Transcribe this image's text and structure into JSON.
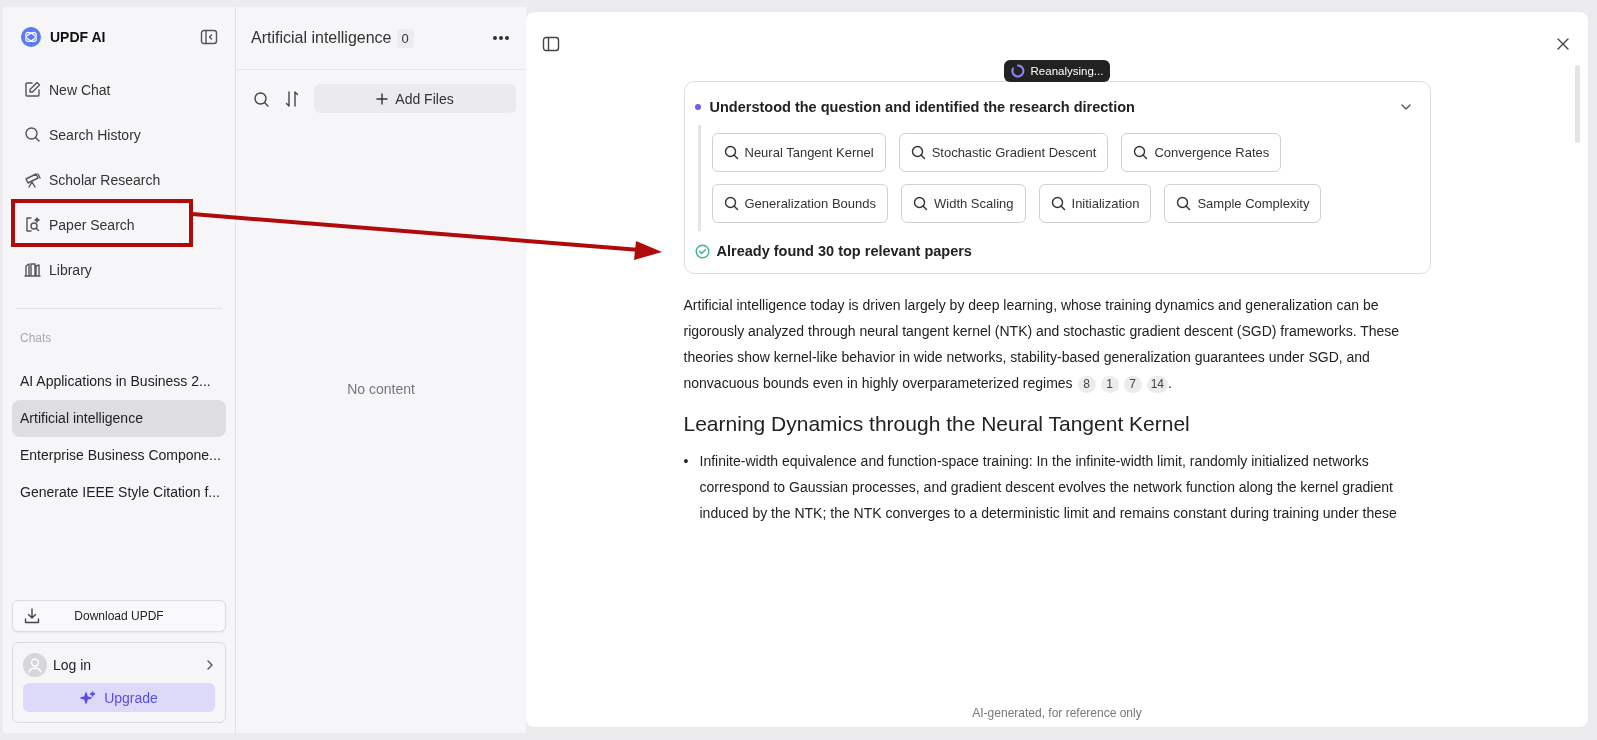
{
  "sidebar": {
    "brand": "UPDF AI",
    "nav": [
      {
        "label": "New Chat",
        "selected": false
      },
      {
        "label": "Search History",
        "selected": false
      },
      {
        "label": "Scholar Research",
        "selected": false
      },
      {
        "label": "Paper Search",
        "selected": false
      },
      {
        "label": "Library",
        "selected": false
      }
    ],
    "chats_heading": "Chats",
    "chats": [
      {
        "label": "AI Applications in Business 2...",
        "selected": false
      },
      {
        "label": "Artificial intelligence",
        "selected": true
      },
      {
        "label": "Enterprise Business Compone...",
        "selected": false
      },
      {
        "label": "Generate IEEE Style Citation f...",
        "selected": false
      }
    ],
    "download_button": "Download UPDF",
    "login": "Log in",
    "upgrade_button": "Upgrade"
  },
  "files_panel": {
    "title": "Artificial intelligence",
    "count": "0",
    "add_button": "Add Files",
    "empty_text": "No content"
  },
  "answer": {
    "status": "Reanalysing...",
    "steps": {
      "title": "Understood the question and identified the research direction",
      "expanded": true,
      "queries": [
        "Neural Tangent Kernel",
        "Stochastic Gradient Descent",
        "Convergence Rates",
        "Generalization Bounds",
        "Width Scaling",
        "Initialization",
        "Sample Complexity"
      ],
      "result": "Already found 30 top relevant papers"
    },
    "paragraph": "Artificial intelligence today is driven largely by deep learning, whose training dynamics and generalization can be rigorously analyzed through neural tangent kernel (NTK) and stochastic gradient descent (SGD) frameworks. These theories show kernel-like behavior in wide networks, stability-based generalization guarantees under SGD, and nonvacuous bounds even in highly overparameterized regimes",
    "citations": [
      "8",
      "1",
      "7",
      "14"
    ],
    "paragraph_end": ".",
    "heading": "Learning Dynamics through the Neural Tangent Kernel",
    "bullets": [
      {
        "marker": "•",
        "text": "Infinite-width equivalence and function-space training: In the infinite-width limit, randomly initialized networks correspond to Gaussian processes, and gradient descent evolves the network function along the kernel gradient induced by the NTK; the NTK converges to a deterministic limit and remains constant during training under these"
      }
    ],
    "footer": "AI-generated, for reference only"
  },
  "annotation": {
    "kind": "arrow"
  }
}
